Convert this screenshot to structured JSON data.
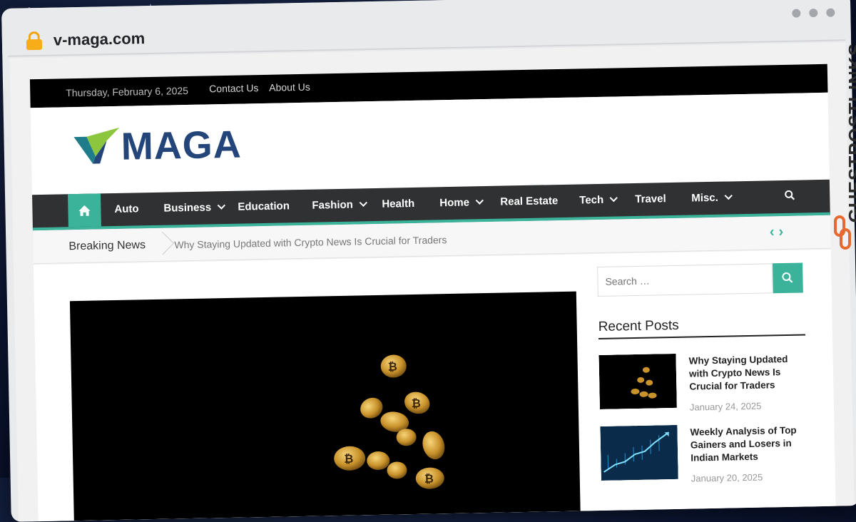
{
  "browser": {
    "url": "v-maga.com"
  },
  "topbar": {
    "date": "Thursday, February 6, 2025",
    "links": [
      "Contact Us",
      "About Us"
    ]
  },
  "brand": {
    "name": "MAGA",
    "colors": {
      "primary": "#23457a",
      "accent": "#3bb39a",
      "mark_green": "#8cc63f"
    }
  },
  "nav": {
    "home_icon": "home-icon",
    "items": [
      {
        "label": "Auto",
        "dropdown": false
      },
      {
        "label": "Business",
        "dropdown": true
      },
      {
        "label": "Education",
        "dropdown": false
      },
      {
        "label": "Fashion",
        "dropdown": true
      },
      {
        "label": "Health",
        "dropdown": false
      },
      {
        "label": "Home",
        "dropdown": true
      },
      {
        "label": "Real Estate",
        "dropdown": false
      },
      {
        "label": "Tech",
        "dropdown": true
      },
      {
        "label": "Travel",
        "dropdown": false
      },
      {
        "label": "Misc.",
        "dropdown": true
      }
    ],
    "search_icon": "search-icon"
  },
  "breaking": {
    "label": "Breaking News",
    "headline": "Why Staying Updated with Crypto News Is Crucial for Traders"
  },
  "sidebar": {
    "search_placeholder": "Search …",
    "recent_title": "Recent Posts",
    "posts": [
      {
        "title": "Why Staying Updated with Crypto News Is Crucial for Traders",
        "date": "January 24, 2025"
      },
      {
        "title": "Weekly Analysis of Top Gainers and Losers in Indian Markets",
        "date": "January 20, 2025"
      }
    ]
  },
  "watermark": "GUESTPOSTLINKS"
}
